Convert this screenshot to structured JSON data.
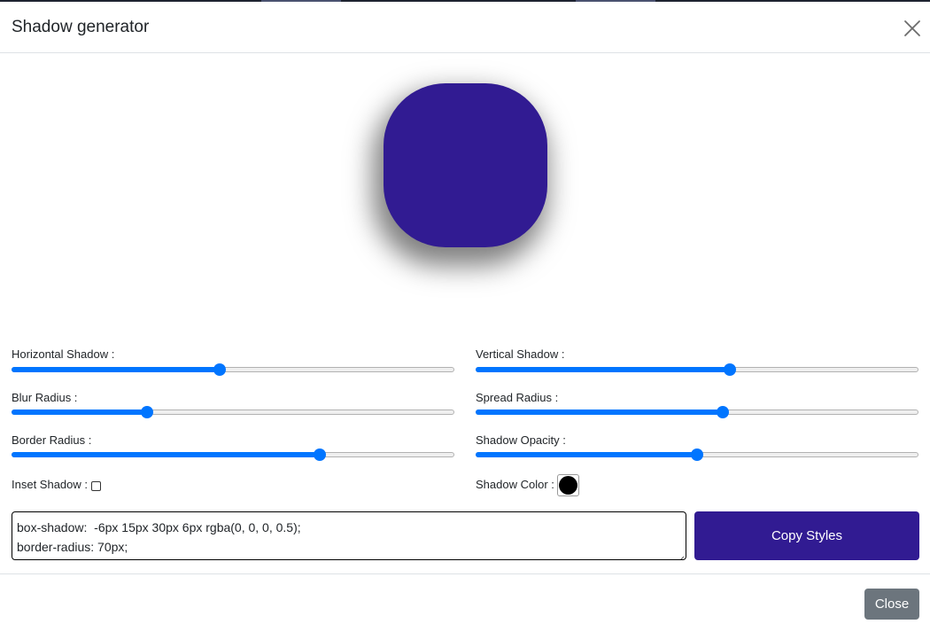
{
  "modal": {
    "title": "Shadow generator",
    "close_icon": "close-icon"
  },
  "preview": {
    "color": "#311b92"
  },
  "controls": {
    "horizontal_shadow": {
      "label": "Horizontal Shadow :",
      "value_fraction": 0.47
    },
    "vertical_shadow": {
      "label": "Vertical Shadow :",
      "value_fraction": 0.573
    },
    "blur_radius": {
      "label": "Blur Radius :",
      "value_fraction": 0.306
    },
    "spread_radius": {
      "label": "Spread Radius :",
      "value_fraction": 0.558
    },
    "border_radius": {
      "label": "Border Radius :",
      "value_fraction": 0.695
    },
    "shadow_opacity": {
      "label": "Shadow Opacity :",
      "value_fraction": 0.5
    },
    "inset_shadow": {
      "label": "Inset Shadow :",
      "checked": false
    },
    "shadow_color": {
      "label": "Shadow Color :",
      "value": "#000000"
    }
  },
  "output": {
    "line1": "box-shadow:  -6px 15px 30px 6px rgba(0, 0, 0, 0.5);",
    "line2": "border-radius: 70px;"
  },
  "buttons": {
    "copy_label": "Copy Styles",
    "close_label": "Close"
  },
  "colors": {
    "accent": "#311b92",
    "slider": "#0075ff",
    "secondary": "#6c757d"
  }
}
